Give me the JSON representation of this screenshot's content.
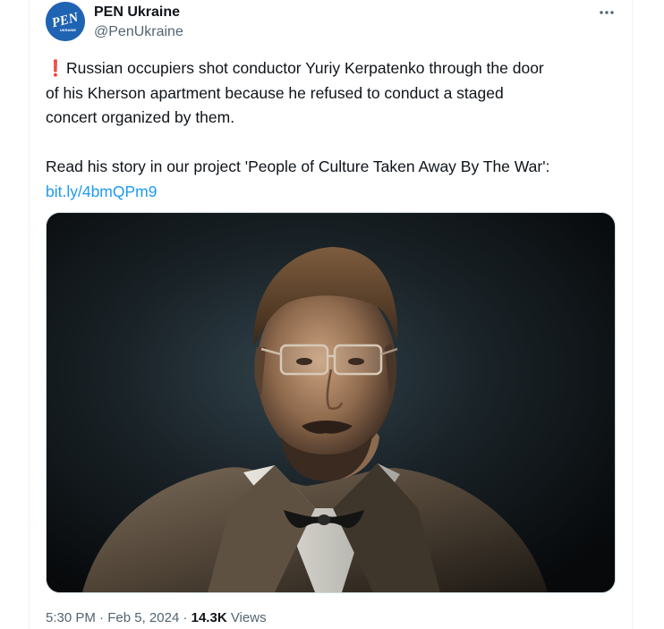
{
  "tweet": {
    "author": {
      "name": "PEN Ukraine",
      "handle": "@PenUkraine",
      "avatar_logo_text": "PEN",
      "avatar_sub_text": "UKRAINE",
      "avatar_color": "#1f63b3"
    },
    "more_icon": "more-dots-icon",
    "alert_icon": "exclamation-icon",
    "alert_glyph": "❗",
    "line1": "Russian occupiers shot conductor Yuriy Kerpatenko through the door",
    "line2": "of his Kherson apartment because he refused to conduct a staged",
    "line3": "concert organized by them.",
    "line4": "Read his story in our project 'People of Culture Taken Away By The War':",
    "link": "bit.ly/4bmQPm9",
    "media": {
      "kind": "image",
      "subject": "painted portrait"
    },
    "time": "5:30 PM",
    "separator": "·",
    "date": "Feb 5, 2024",
    "views_count": "14.3K",
    "views_label": "Views",
    "colors": {
      "text": "#0f1419",
      "secondary": "#536471",
      "link": "#1d9bf0",
      "alert": "#e0252b"
    }
  }
}
